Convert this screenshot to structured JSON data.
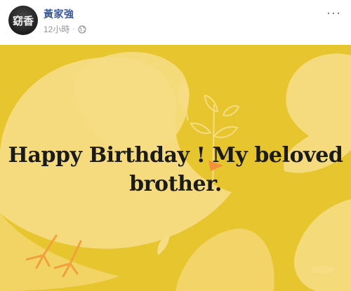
{
  "post": {
    "author_name": "黃家強",
    "avatar_text": "窈香",
    "timestamp": "12小時",
    "separator": "·",
    "privacy_icon": "globe-icon",
    "more_icon": "more-options-icon",
    "more_label": "···"
  },
  "card": {
    "background_color": "#e6c52f",
    "accent_color": "#f6dc83",
    "line_1": "Happy Birthday ! My beloved",
    "line_2": "brother."
  }
}
